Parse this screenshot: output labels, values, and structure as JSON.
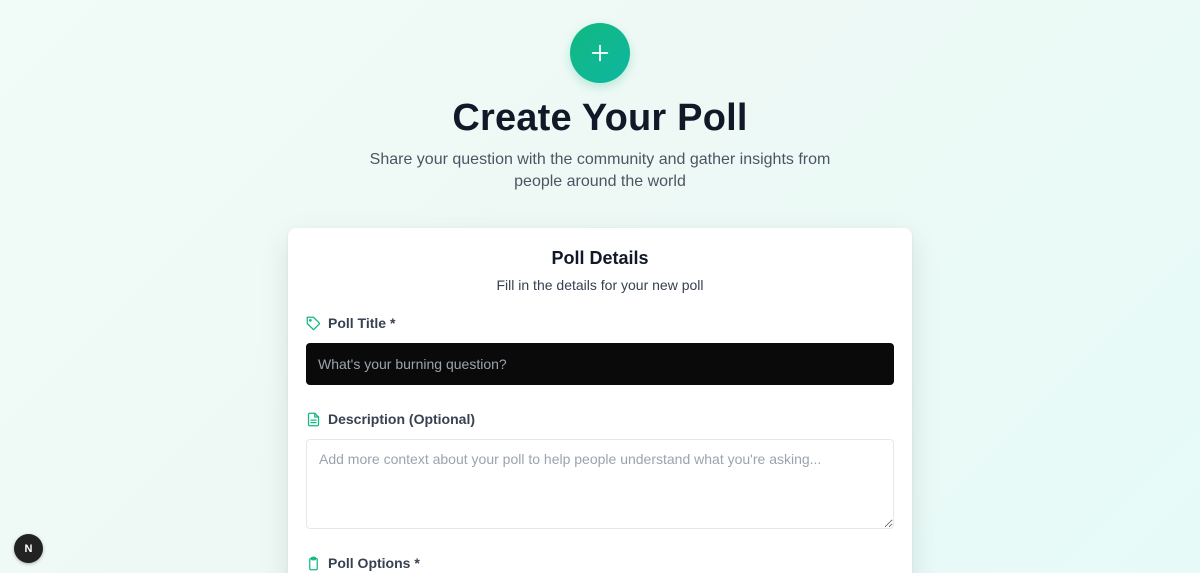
{
  "hero": {
    "title": "Create Your Poll",
    "subtitle": "Share your question with the community and gather insights from people around the world",
    "add_icon": "plus-icon",
    "accent_color": "#10b981"
  },
  "card": {
    "title": "Poll Details",
    "subtitle": "Fill in the details for your new poll",
    "fields": {
      "title": {
        "label": "Poll Title *",
        "icon": "tag-icon",
        "placeholder": "What's your burning question?",
        "value": ""
      },
      "description": {
        "label": "Description (Optional)",
        "icon": "document-icon",
        "placeholder": "Add more context about your poll to help people understand what you're asking...",
        "value": ""
      },
      "options": {
        "label": "Poll Options *",
        "icon": "clipboard-icon"
      }
    }
  },
  "dev_badge": {
    "label": "N",
    "icon": "nextjs-icon"
  }
}
